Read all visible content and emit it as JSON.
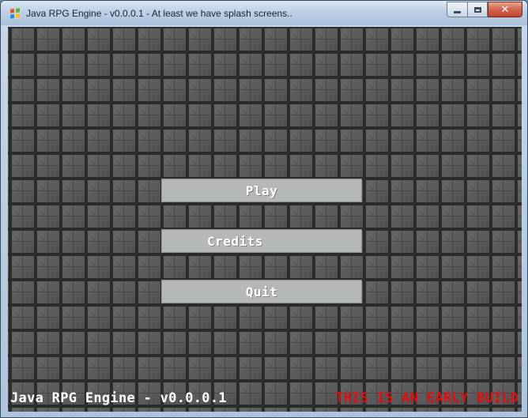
{
  "window": {
    "title": "Java RPG Engine - v0.0.0.1 - At least we have splash screens..",
    "icon": "windows-flag-icon",
    "minimize_icon": "minimize-icon",
    "maximize_icon": "maximize-icon",
    "close_label": "✕"
  },
  "menu": {
    "play_label": "Play",
    "credits_label": "Credits",
    "quit_label": "Quit"
  },
  "footer": {
    "version_text": "Java RPG Engine - v0.0.0.1",
    "build_notice": "THIS IS AN EARLY BUILD"
  },
  "colors": {
    "build_notice": "#e01010",
    "button_face": "#b4b8b6",
    "tile_base": "#5a5a5a"
  }
}
